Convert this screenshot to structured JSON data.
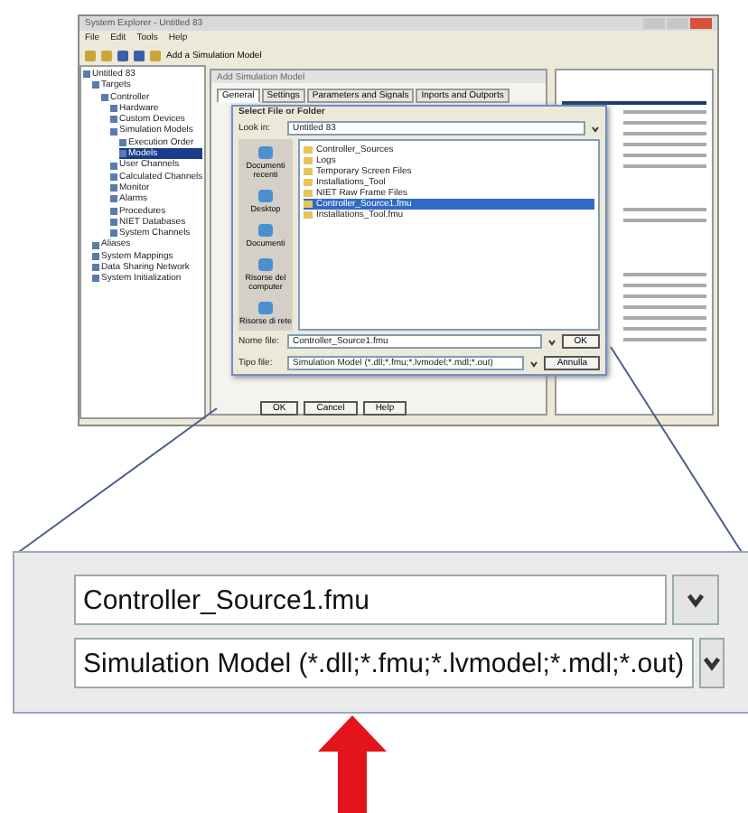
{
  "app_window": {
    "title": "System Explorer - Untitled 83",
    "menu": [
      "File",
      "Edit",
      "Tools",
      "Help"
    ],
    "toolbar_button": "Add a Simulation Model"
  },
  "tree": [
    {
      "label": "Untitled 83",
      "selected": false,
      "children": [
        {
          "label": "Targets",
          "selected": false,
          "children": [
            {
              "label": "Controller",
              "selected": false,
              "children": [
                {
                  "label": "Hardware",
                  "selected": false
                },
                {
                  "label": "Custom Devices",
                  "selected": false
                },
                {
                  "label": "Simulation Models",
                  "selected": false,
                  "children": [
                    {
                      "label": "Execution Order",
                      "selected": false
                    },
                    {
                      "label": "Models",
                      "selected": true
                    }
                  ]
                },
                {
                  "label": "User Channels",
                  "selected": false
                },
                {
                  "label": "Calculated Channels",
                  "selected": false
                },
                {
                  "label": "Monitor",
                  "selected": false
                },
                {
                  "label": "Alarms",
                  "selected": false
                },
                {
                  "label": "Procedures",
                  "selected": false
                },
                {
                  "label": "NIET Databases",
                  "selected": false
                },
                {
                  "label": "System Channels",
                  "selected": false
                }
              ]
            }
          ]
        },
        {
          "label": "Aliases",
          "selected": false
        },
        {
          "label": "System Mappings",
          "selected": false
        },
        {
          "label": "Data Sharing Network",
          "selected": false
        },
        {
          "label": "System Initialization",
          "selected": false
        }
      ]
    }
  ],
  "properties_window": {
    "title": "Add Simulation Model",
    "tabs": [
      {
        "label": "General",
        "selected": true
      },
      {
        "label": "Settings",
        "selected": false
      },
      {
        "label": "Parameters and Signals",
        "selected": false
      },
      {
        "label": "Inports and Outports",
        "selected": false
      }
    ]
  },
  "file_dialog": {
    "title": "Select File or Folder",
    "look_in_label": "Look in:",
    "look_in": "Untitled 83",
    "places": [
      "Documenti recenti",
      "Desktop",
      "Documenti",
      "Risorse del computer",
      "Risorse di rete"
    ],
    "files": [
      {
        "name": "Controller_Sources",
        "selected": false
      },
      {
        "name": "Logs",
        "selected": false
      },
      {
        "name": "Temporary Screen Files",
        "selected": false
      },
      {
        "name": "Installations_Tool",
        "selected": false
      },
      {
        "name": "NIET Raw Frame Files",
        "selected": false
      },
      {
        "name": "Controller_Source1.fmu",
        "selected": true
      },
      {
        "name": "Installations_Tool.fmu",
        "selected": false
      }
    ],
    "file_name_label": "Nome file:",
    "file_name": "Controller_Source1.fmu",
    "file_type_label": "Tipo file:",
    "file_type": "Simulation Model (*.dll;*.fmu;*.lvmodel;*.mdl;*.out)",
    "buttons": [
      "OK",
      "Annulla"
    ]
  },
  "bottom_buttons": [
    "OK",
    "Cancel",
    "Help"
  ],
  "inset": {
    "file_name": "Controller_Source1.fmu",
    "file_type": "Simulation Model (*.dll;*.fmu;*.lvmodel;*.mdl;*.out)"
  }
}
